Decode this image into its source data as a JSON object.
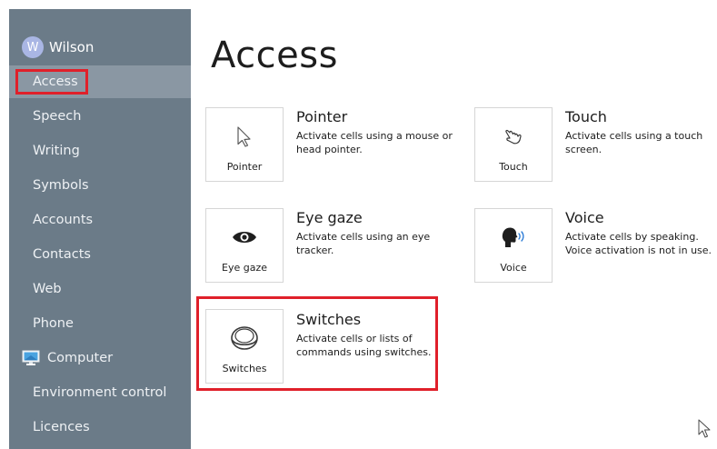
{
  "sidebar": {
    "user": {
      "initial": "W",
      "name": "Wilson"
    },
    "items": [
      {
        "label": "Access",
        "active": true
      },
      {
        "label": "Speech"
      },
      {
        "label": "Writing"
      },
      {
        "label": "Symbols"
      },
      {
        "label": "Accounts"
      },
      {
        "label": "Contacts"
      },
      {
        "label": "Web"
      },
      {
        "label": "Phone"
      },
      {
        "label": "Computer",
        "icon": "monitor-icon"
      },
      {
        "label": "Environment control"
      },
      {
        "label": "Licences"
      }
    ]
  },
  "main": {
    "title": "Access",
    "options": [
      {
        "tile_label": "Pointer",
        "icon": "pointer-arrow-icon",
        "title": "Pointer",
        "description": "Activate cells using a mouse or head pointer."
      },
      {
        "tile_label": "Touch",
        "icon": "touch-hand-icon",
        "title": "Touch",
        "description": "Activate cells using a touch screen."
      },
      {
        "tile_label": "Eye gaze",
        "icon": "eye-icon",
        "title": "Eye gaze",
        "description": "Activate cells using an eye tracker."
      },
      {
        "tile_label": "Voice",
        "icon": "voice-head-icon",
        "title": "Voice",
        "description": "Activate cells by speaking. Voice activation is not in use."
      },
      {
        "tile_label": "Switches",
        "icon": "switch-button-icon",
        "title": "Switches",
        "description": "Activate cells or lists of commands using switches."
      }
    ]
  },
  "colors": {
    "sidebar_bg": "#6b7b88",
    "sidebar_active_bg": "#8a97a3",
    "highlight_red": "#e0202a",
    "avatar_bg": "#a9b6e4"
  }
}
